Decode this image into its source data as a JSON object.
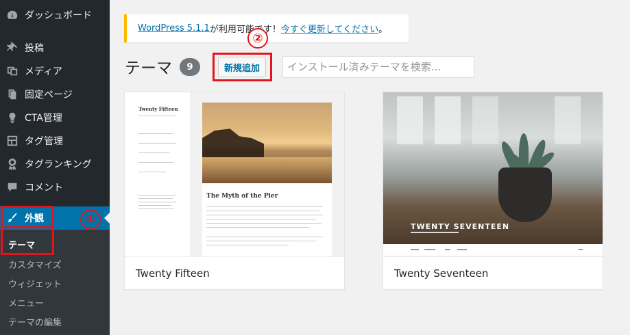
{
  "sidebar": {
    "items": [
      {
        "label": "ダッシュボード",
        "icon": "dashboard-icon"
      },
      {
        "label": "投稿",
        "icon": "pin-icon"
      },
      {
        "label": "メディア",
        "icon": "media-icon"
      },
      {
        "label": "固定ページ",
        "icon": "pages-icon"
      },
      {
        "label": "CTA管理",
        "icon": "lightbulb-icon"
      },
      {
        "label": "タグ管理",
        "icon": "layout-icon"
      },
      {
        "label": "タグランキング",
        "icon": "award-icon"
      },
      {
        "label": "コメント",
        "icon": "comment-icon"
      },
      {
        "label": "外観",
        "icon": "paintbrush-icon"
      }
    ],
    "submenu": [
      "テーマ",
      "カスタマイズ",
      "ウィジェット",
      "メニュー",
      "テーマの編集"
    ]
  },
  "annotations": {
    "step1": "①",
    "step2": "②"
  },
  "notice": {
    "link1": "WordPress 5.1.1",
    "middle": " が利用可能です！",
    "link2": "今すぐ更新してください",
    "end": "。"
  },
  "header": {
    "title": "テーマ",
    "count": "9",
    "add_new": "新規追加",
    "search_placeholder": "インストール済みテーマを検索..."
  },
  "themes": [
    {
      "name": "Twenty Fifteen",
      "preview_site_title": "Twenty Fifteen",
      "preview_post_title": "The Myth of the Pier"
    },
    {
      "name": "Twenty Seventeen",
      "preview_site_title": "TWENTY SEVENTEEN"
    }
  ],
  "colors": {
    "sidebar": "#23282d",
    "active": "#0073aa",
    "notice_border": "#ffb900",
    "annotation": "#e5141c"
  }
}
